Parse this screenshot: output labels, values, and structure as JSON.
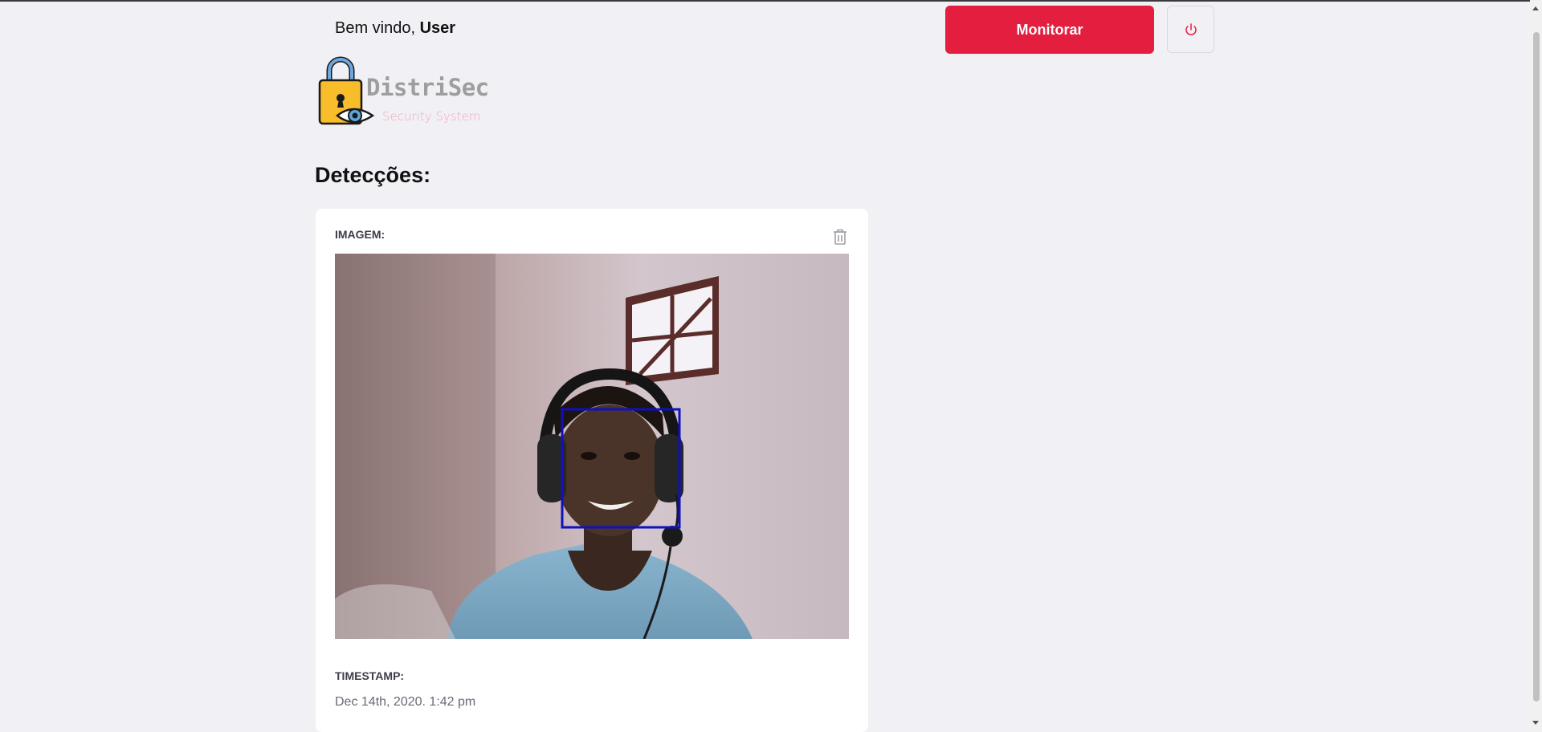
{
  "header": {
    "greeting_prefix": "Bem vindo, ",
    "user_name": "User",
    "monitor_label": "Monitorar"
  },
  "logo": {
    "name": "DistriSec",
    "tagline": "Security System"
  },
  "main": {
    "title": "Detecções:"
  },
  "detection": {
    "image_label": "IMAGEM:",
    "timestamp_label": "TIMESTAMP:",
    "timestamp_value": "Dec 14th, 2020. 1:42 pm"
  },
  "colors": {
    "accent": "#e41e3f",
    "background": "#f0f0f5",
    "detection_box": "#1010c0"
  },
  "icons": {
    "power": "power-icon",
    "delete": "trash-icon",
    "logo": "padlock-eye-icon"
  }
}
